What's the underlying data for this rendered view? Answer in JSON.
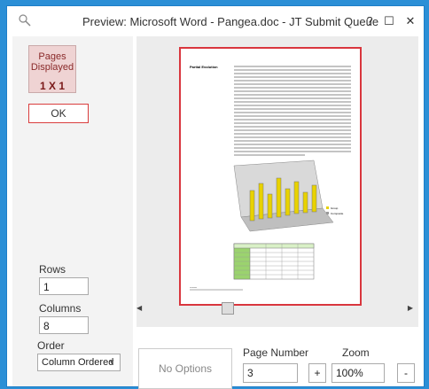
{
  "window": {
    "title": "Preview:  Microsoft Word - Pangea.doc  -  JT Submit Queue",
    "help_label": "?",
    "maximize_label": "☐",
    "close_label": "✕"
  },
  "left_panel": {
    "pages_displayed_label": "Pages\nDisplayed",
    "pages_displayed_value": "1 X 1",
    "ok_label": "OK",
    "rows_label": "Rows",
    "rows_value": "1",
    "columns_label": "Columns",
    "columns_value": "8",
    "order_label": "Order",
    "order_value": "Column Ordered"
  },
  "bottom": {
    "no_options_label": "No Options",
    "page_number_label": "Page Number",
    "page_number_value": "3",
    "page_increment_label": "+",
    "zoom_label": "Zoom",
    "zoom_value": "100%",
    "zoom_decrement_label": "-"
  },
  "document_page": {
    "heading_left": "Partial Evolution",
    "table_header": [
      "",
      "Co. Partner",
      "Co. Repository",
      "Co. Bit Cycle"
    ],
    "chart_legend": [
      "Group",
      "Composite"
    ]
  }
}
